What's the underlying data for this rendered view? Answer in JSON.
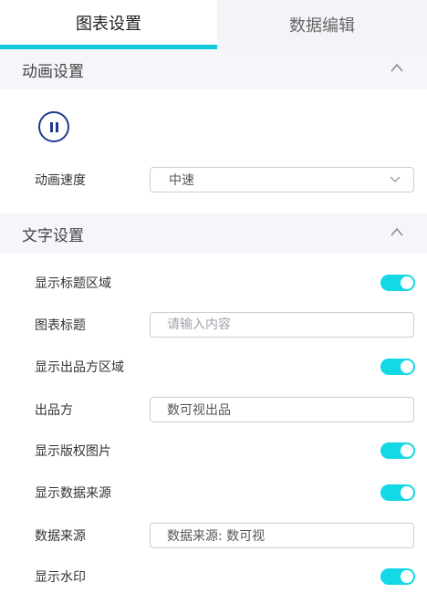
{
  "tabs": [
    {
      "label": "图表设置",
      "active": true
    },
    {
      "label": "数据编辑",
      "active": false
    }
  ],
  "animation": {
    "title": "动画设置",
    "speed_label": "动画速度",
    "speed_value": "中速"
  },
  "text": {
    "title": "文字设置",
    "show_title_area": "显示标题区域",
    "chart_title_label": "图表标题",
    "chart_title_placeholder": "请输入内容",
    "show_producer_area": "显示出品方区域",
    "producer_label": "出品方",
    "producer_value": "数可视出品",
    "show_copyright_image": "显示版权图片",
    "show_data_source": "显示数据来源",
    "data_source_label": "数据来源",
    "data_source_value": "数据来源: 数可视",
    "show_watermark": "显示水印"
  },
  "colors": {
    "accent": "#14c8de",
    "toggle_on": "#14d8e6",
    "pause": "#1f3a8f"
  }
}
